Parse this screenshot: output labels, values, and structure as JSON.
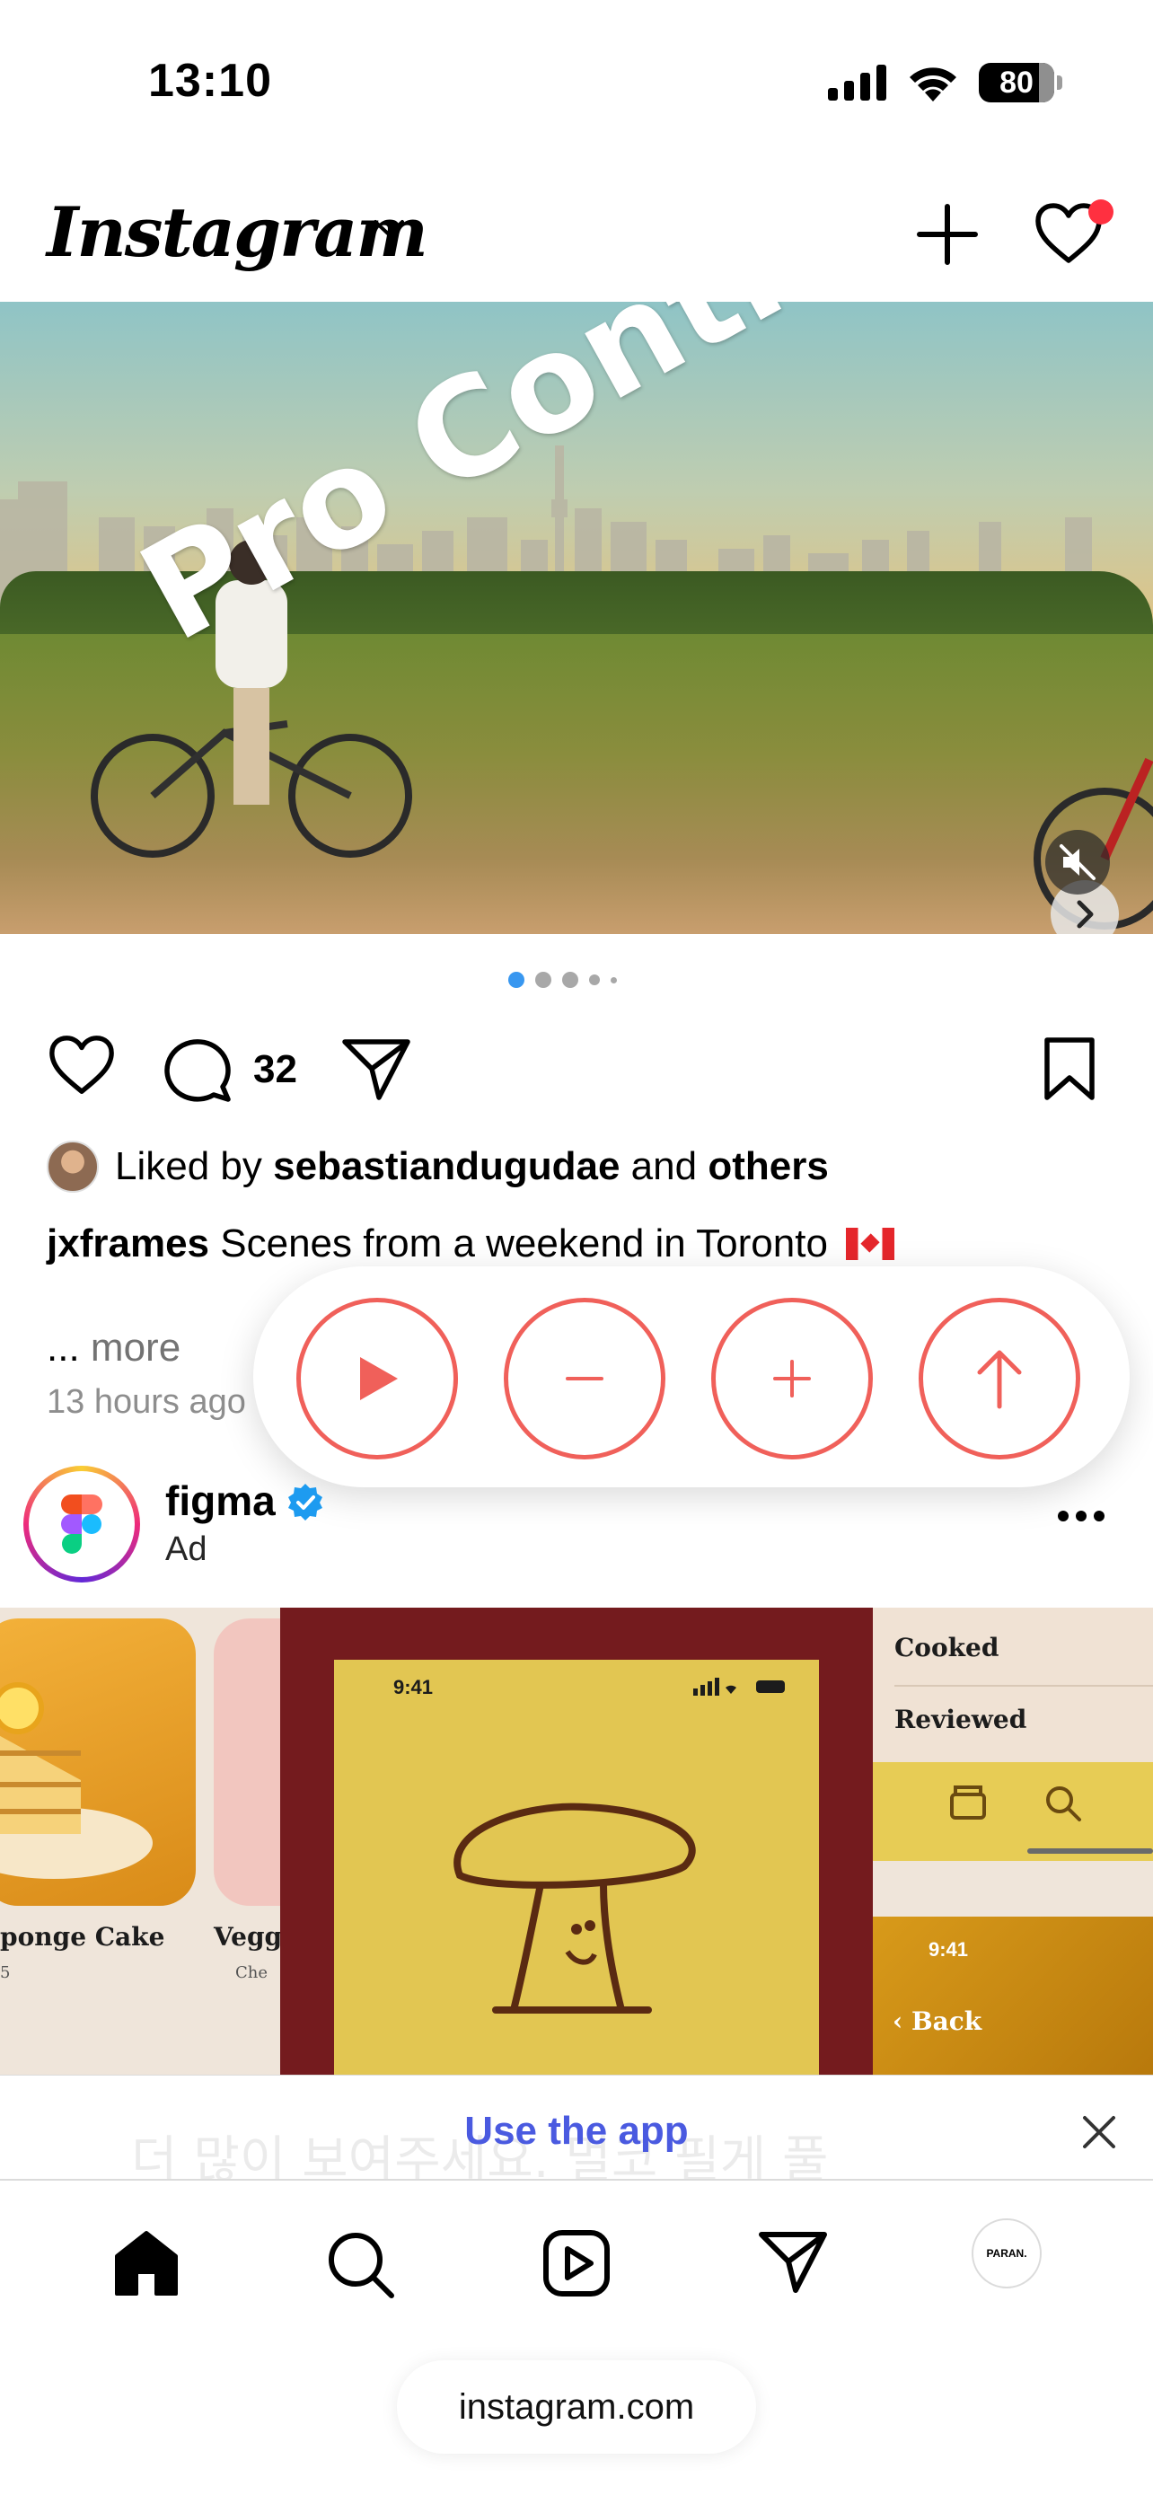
{
  "status_bar": {
    "time": "13:10",
    "battery": "80"
  },
  "header": {
    "logo": "Instagram"
  },
  "post": {
    "overlay_text": "Pro Controls",
    "comment_count": "32",
    "liked_by_prefix": "Liked by",
    "liked_by_user": "sebastiandugudae",
    "liked_by_and": "and",
    "liked_by_others": "others",
    "author": "jxframes",
    "caption": "Scenes from a weekend in Toronto",
    "more_prefix": "...",
    "more_link": "more",
    "time_ago": "13 hours ago",
    "carousel_active_index": 0,
    "carousel_count": 5
  },
  "pro_controls": {
    "buttons": [
      "play",
      "minus",
      "plus",
      "arrow-up"
    ]
  },
  "ad": {
    "name": "figma",
    "label": "Ad",
    "media": {
      "card1_title": "ponge Cake",
      "card1_sub": "5",
      "card2_title": "Veggi",
      "card2_sub": "Che",
      "phone_time": "9:41",
      "panel_item1": "Cooked",
      "panel_item2": "Reviewed",
      "panel_time": "9:41",
      "panel_back": "Back"
    }
  },
  "banner": {
    "label": "Use the app",
    "ghost_text": "더 많이 보여주세요. 멀코 필게 풀"
  },
  "tab_bar": {
    "profile_label": "PARAN."
  },
  "browser": {
    "url": "instagram.com"
  },
  "colors": {
    "accent": "#f0605a",
    "like_dot": "#ff3040",
    "link": "#4a5ae0",
    "verified": "#1d9bf0"
  }
}
